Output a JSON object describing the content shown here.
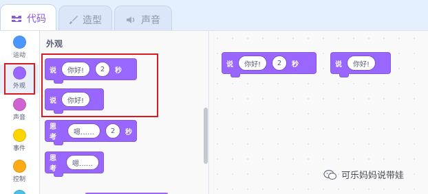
{
  "tabs": [
    {
      "label": "代码",
      "icon": "code-icon",
      "active": true
    },
    {
      "label": "造型",
      "icon": "paintbrush-icon",
      "active": false
    },
    {
      "label": "声音",
      "icon": "speaker-icon",
      "active": false
    }
  ],
  "categories": [
    {
      "label": "运动",
      "color": "#4c97ff"
    },
    {
      "label": "外观",
      "color": "#9966ff",
      "selected": true
    },
    {
      "label": "声音",
      "color": "#cf63cf"
    },
    {
      "label": "事件",
      "color": "#ffd500"
    },
    {
      "label": "控制",
      "color": "#ffab19"
    },
    {
      "label": "",
      "color": "#4cbfe6"
    }
  ],
  "palette": {
    "title": "外观",
    "blocks": [
      {
        "keyword": "说",
        "message": "你好!",
        "seconds": "2",
        "suffix": "秒"
      },
      {
        "keyword": "说",
        "message": "你好!"
      },
      {
        "keyword": "思考",
        "message": "嗯……",
        "seconds": "2",
        "suffix": "秒"
      },
      {
        "keyword": "思考",
        "message": "嗯……"
      }
    ]
  },
  "canvas": {
    "blocks": [
      {
        "keyword": "说",
        "message": "你好!",
        "seconds": "2",
        "suffix": "秒"
      },
      {
        "keyword": "说",
        "message": "你好!"
      }
    ]
  },
  "watermark": {
    "text": "可乐妈妈说带娃"
  },
  "colors": {
    "looks_block": "#9966ff",
    "highlight_box": "#d9191f",
    "active_tab_text": "#855cd6"
  }
}
